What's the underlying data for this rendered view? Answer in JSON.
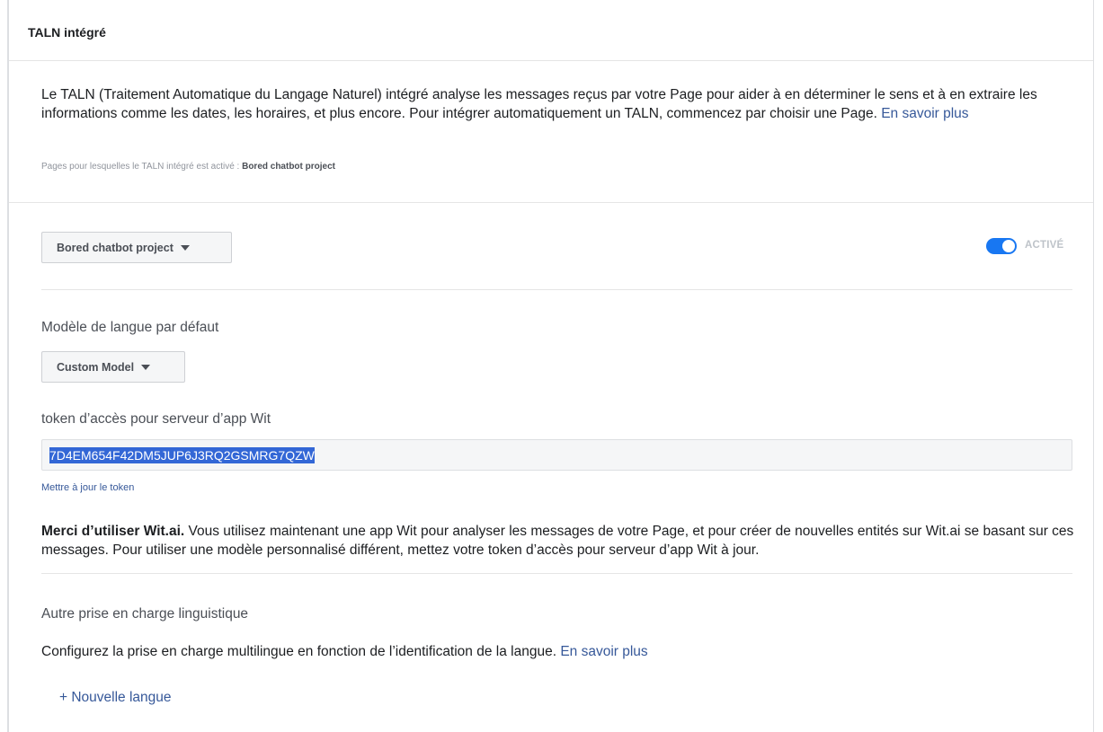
{
  "header": {
    "title": "TALN intégré"
  },
  "intro": {
    "text": "Le TALN (Traitement Automatique du Langage Naturel) intégré analyse les messages reçus par votre Page pour aider à en déterminer le sens et à en extraire les informations comme les dates, les horaires, et plus encore. Pour intégrer automatiquement un TALN, commencez par choisir une Page.",
    "learn_more": "En savoir plus"
  },
  "pages_note": {
    "label": "Pages pour lesquelles le TALN intégré est activé :",
    "value": "Bored chatbot project"
  },
  "page_selector": {
    "label": "Bored chatbot project",
    "icon": "caret-down-icon"
  },
  "toggle": {
    "state": "on",
    "label": "ACTIVÉ",
    "color": "#1877f2"
  },
  "model": {
    "label": "Modèle de langue par défaut",
    "selected": "Custom Model"
  },
  "token": {
    "label": "token d’accès pour serveur d’app Wit",
    "value": "7D4EM654F42DM5JUP6J3RQ2GSMRG7QZW",
    "update_link": "Mettre à jour le token"
  },
  "thanks": {
    "bold": "Merci d’utiliser Wit.ai.",
    "text": " Vous utilisez maintenant une app Wit pour analyser les messages de votre Page, et pour créer de nouvelles entités sur Wit.ai se basant sur ces messages. Pour utiliser une modèle personnalisé différent, mettez votre token d’accès pour serveur d’app Wit à jour."
  },
  "language_support": {
    "heading": "Autre prise en charge linguistique",
    "text": "Configurez la prise en charge multilingue en fonction de l’identification de la langue.",
    "learn_more": "En savoir plus",
    "add_language": "+ Nouvelle langue"
  },
  "colors": {
    "link": "#365899",
    "selection": "#3367d6"
  }
}
